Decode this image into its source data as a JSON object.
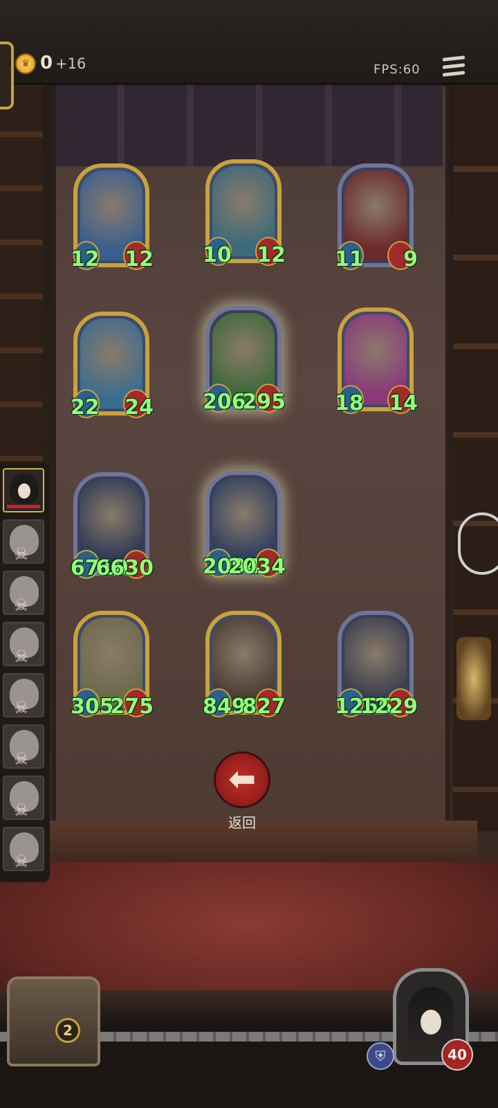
{
  "top_bar": {
    "coin_count": "0",
    "coin_delta": "+16",
    "fps": "FPS:60",
    "menu_icon": "hamburger-menu-icon"
  },
  "cards": [
    {
      "attack": "12",
      "health": "12",
      "frame": "gold"
    },
    {
      "attack": "10",
      "health": "12",
      "frame": "gold"
    },
    {
      "attack": "11",
      "health": "9",
      "frame": "blue"
    },
    {
      "attack": "22",
      "health": "24",
      "frame": "gold"
    },
    {
      "attack": "206",
      "health": "295",
      "frame": "blue"
    },
    {
      "attack": "18",
      "health": "14",
      "frame": "gold"
    },
    {
      "attack": "6710",
      "health": "6630",
      "frame": "blue"
    },
    {
      "attack": "2094",
      "health": "2034",
      "frame": "blue"
    },
    {
      "attack": "305",
      "health": "275",
      "frame": "gold"
    },
    {
      "attack": "849",
      "health": "827",
      "frame": "gold"
    },
    {
      "attack": "1266",
      "health": "1229",
      "frame": "blue"
    }
  ],
  "roster": {
    "slot_count": 8,
    "active_index": 0,
    "defeated_icon": "skull-icon"
  },
  "back_button": {
    "label": "返回",
    "icon": "arrow-left-icon"
  },
  "bottom_hud": {
    "deck_count": "2",
    "hero_health": "40",
    "armor_icon": "shield-icon"
  },
  "colors": {
    "stat_text": "#8fff7a",
    "gold_frame": "#c9a23b",
    "blue_frame": "#6f7598",
    "back_button": "#b0241f"
  }
}
